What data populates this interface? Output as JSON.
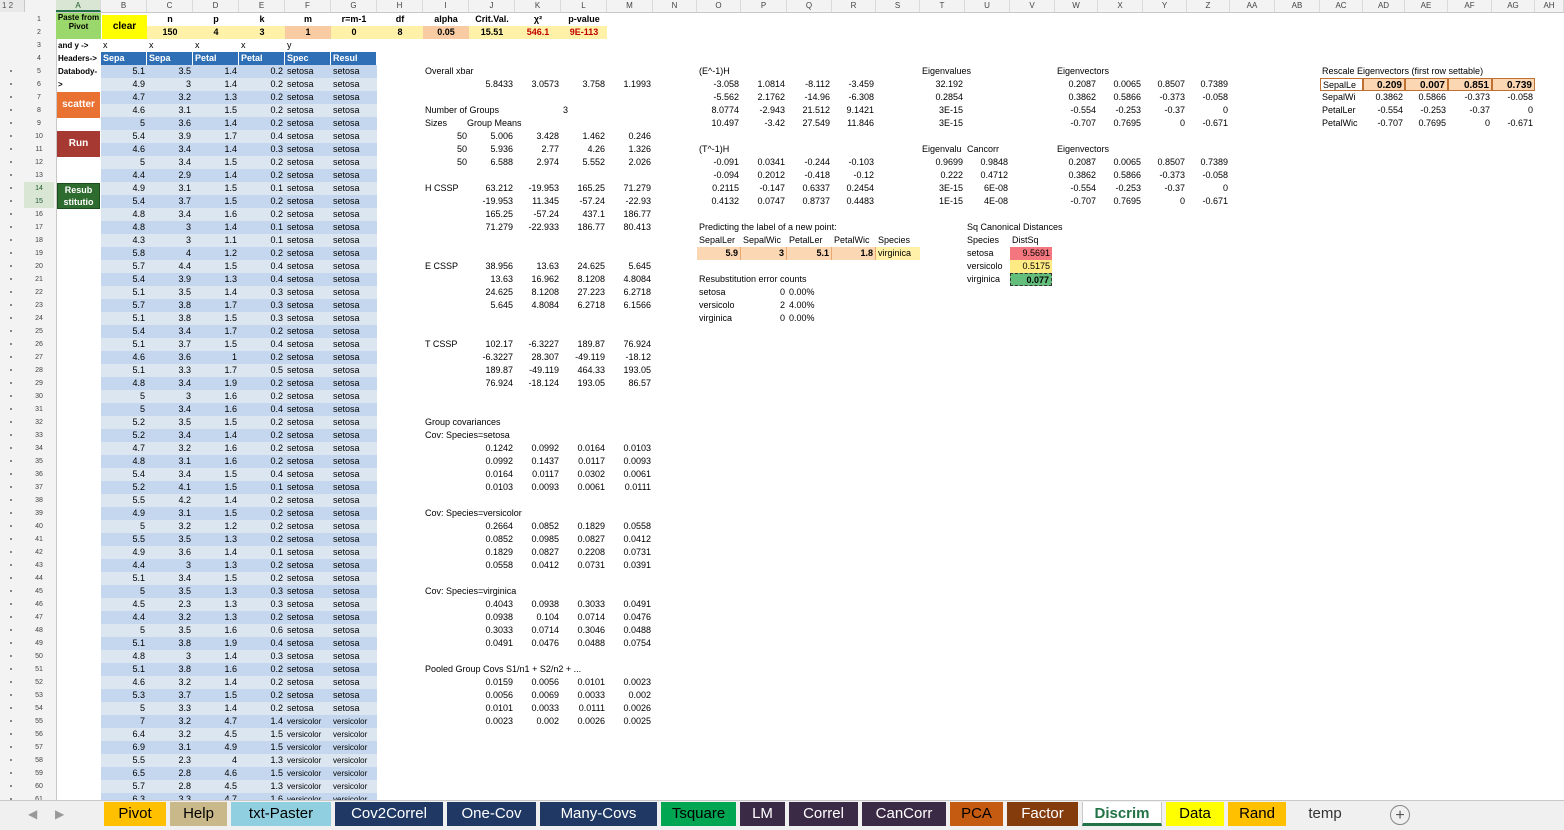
{
  "outline_levels": "1 2",
  "columns": [
    "A",
    "B",
    "C",
    "D",
    "E",
    "F",
    "G",
    "H",
    "I",
    "J",
    "K",
    "L",
    "M",
    "N",
    "O",
    "P",
    "Q",
    "R",
    "S",
    "T",
    "U",
    "V",
    "W",
    "X",
    "Y",
    "Z",
    "AA",
    "AB",
    "AC",
    "AD",
    "AE",
    "AF",
    "AG",
    "AH"
  ],
  "selected_column": "A",
  "row_numbers": [
    "1",
    "2",
    "3",
    "4",
    "5",
    "6",
    "7",
    "8",
    "9",
    "10",
    "11",
    "12",
    "13",
    "14",
    "15",
    "16",
    "17",
    "18",
    "19",
    "20",
    "21",
    "22",
    "23",
    "24",
    "25",
    "26",
    "27",
    "28",
    "29",
    "30",
    "31",
    "32",
    "33",
    "34",
    "35",
    "36",
    "37",
    "38",
    "39",
    "40",
    "41",
    "42",
    "43",
    "44",
    "45",
    "46",
    "47",
    "48",
    "49",
    "50",
    "51",
    "52",
    "53",
    "54",
    "55",
    "56",
    "57",
    "58",
    "59",
    "60",
    "61"
  ],
  "selected_rows": [
    "14",
    "15"
  ],
  "row_labels": {
    "r1": "Paste from Pivot",
    "r3": "and y ->",
    "r4": "Headers->",
    "r5": "Databody->"
  },
  "buttons": {
    "clear": "clear",
    "scatter": "scatter",
    "run": "Run",
    "resub": "Resub stitutio"
  },
  "params": {
    "headers": [
      "n",
      "p",
      "k",
      "m",
      "r=m-1",
      "df",
      "alpha",
      "Crit.Val.",
      "χ²",
      "p-value"
    ],
    "values": [
      "150",
      "4",
      "3",
      "1",
      "0",
      "8",
      "0.05",
      "15.51",
      "546.1",
      "9E-113"
    ]
  },
  "row3_marks": [
    "x",
    "x",
    "x",
    "x",
    "y"
  ],
  "table": {
    "headers": [
      "Sepa",
      "Sepa",
      "Petal",
      "Petal",
      "Spec",
      "Resul"
    ],
    "rows": [
      [
        "5.1",
        "3.5",
        "1.4",
        "0.2",
        "setosa",
        "setosa"
      ],
      [
        "4.9",
        "3",
        "1.4",
        "0.2",
        "setosa",
        "setosa"
      ],
      [
        "4.7",
        "3.2",
        "1.3",
        "0.2",
        "setosa",
        "setosa"
      ],
      [
        "4.6",
        "3.1",
        "1.5",
        "0.2",
        "setosa",
        "setosa"
      ],
      [
        "5",
        "3.6",
        "1.4",
        "0.2",
        "setosa",
        "setosa"
      ],
      [
        "5.4",
        "3.9",
        "1.7",
        "0.4",
        "setosa",
        "setosa"
      ],
      [
        "4.6",
        "3.4",
        "1.4",
        "0.3",
        "setosa",
        "setosa"
      ],
      [
        "5",
        "3.4",
        "1.5",
        "0.2",
        "setosa",
        "setosa"
      ],
      [
        "4.4",
        "2.9",
        "1.4",
        "0.2",
        "setosa",
        "setosa"
      ],
      [
        "4.9",
        "3.1",
        "1.5",
        "0.1",
        "setosa",
        "setosa"
      ],
      [
        "5.4",
        "3.7",
        "1.5",
        "0.2",
        "setosa",
        "setosa"
      ],
      [
        "4.8",
        "3.4",
        "1.6",
        "0.2",
        "setosa",
        "setosa"
      ],
      [
        "4.8",
        "3",
        "1.4",
        "0.1",
        "setosa",
        "setosa"
      ],
      [
        "4.3",
        "3",
        "1.1",
        "0.1",
        "setosa",
        "setosa"
      ],
      [
        "5.8",
        "4",
        "1.2",
        "0.2",
        "setosa",
        "setosa"
      ],
      [
        "5.7",
        "4.4",
        "1.5",
        "0.4",
        "setosa",
        "setosa"
      ],
      [
        "5.4",
        "3.9",
        "1.3",
        "0.4",
        "setosa",
        "setosa"
      ],
      [
        "5.1",
        "3.5",
        "1.4",
        "0.3",
        "setosa",
        "setosa"
      ],
      [
        "5.7",
        "3.8",
        "1.7",
        "0.3",
        "setosa",
        "setosa"
      ],
      [
        "5.1",
        "3.8",
        "1.5",
        "0.3",
        "setosa",
        "setosa"
      ],
      [
        "5.4",
        "3.4",
        "1.7",
        "0.2",
        "setosa",
        "setosa"
      ],
      [
        "5.1",
        "3.7",
        "1.5",
        "0.4",
        "setosa",
        "setosa"
      ],
      [
        "4.6",
        "3.6",
        "1",
        "0.2",
        "setosa",
        "setosa"
      ],
      [
        "5.1",
        "3.3",
        "1.7",
        "0.5",
        "setosa",
        "setosa"
      ],
      [
        "4.8",
        "3.4",
        "1.9",
        "0.2",
        "setosa",
        "setosa"
      ],
      [
        "5",
        "3",
        "1.6",
        "0.2",
        "setosa",
        "setosa"
      ],
      [
        "5",
        "3.4",
        "1.6",
        "0.4",
        "setosa",
        "setosa"
      ],
      [
        "5.2",
        "3.5",
        "1.5",
        "0.2",
        "setosa",
        "setosa"
      ],
      [
        "5.2",
        "3.4",
        "1.4",
        "0.2",
        "setosa",
        "setosa"
      ],
      [
        "4.7",
        "3.2",
        "1.6",
        "0.2",
        "setosa",
        "setosa"
      ],
      [
        "4.8",
        "3.1",
        "1.6",
        "0.2",
        "setosa",
        "setosa"
      ],
      [
        "5.4",
        "3.4",
        "1.5",
        "0.4",
        "setosa",
        "setosa"
      ],
      [
        "5.2",
        "4.1",
        "1.5",
        "0.1",
        "setosa",
        "setosa"
      ],
      [
        "5.5",
        "4.2",
        "1.4",
        "0.2",
        "setosa",
        "setosa"
      ],
      [
        "4.9",
        "3.1",
        "1.5",
        "0.2",
        "setosa",
        "setosa"
      ],
      [
        "5",
        "3.2",
        "1.2",
        "0.2",
        "setosa",
        "setosa"
      ],
      [
        "5.5",
        "3.5",
        "1.3",
        "0.2",
        "setosa",
        "setosa"
      ],
      [
        "4.9",
        "3.6",
        "1.4",
        "0.1",
        "setosa",
        "setosa"
      ],
      [
        "4.4",
        "3",
        "1.3",
        "0.2",
        "setosa",
        "setosa"
      ],
      [
        "5.1",
        "3.4",
        "1.5",
        "0.2",
        "setosa",
        "setosa"
      ],
      [
        "5",
        "3.5",
        "1.3",
        "0.3",
        "setosa",
        "setosa"
      ],
      [
        "4.5",
        "2.3",
        "1.3",
        "0.3",
        "setosa",
        "setosa"
      ],
      [
        "4.4",
        "3.2",
        "1.3",
        "0.2",
        "setosa",
        "setosa"
      ],
      [
        "5",
        "3.5",
        "1.6",
        "0.6",
        "setosa",
        "setosa"
      ],
      [
        "5.1",
        "3.8",
        "1.9",
        "0.4",
        "setosa",
        "setosa"
      ],
      [
        "4.8",
        "3",
        "1.4",
        "0.3",
        "setosa",
        "setosa"
      ],
      [
        "5.1",
        "3.8",
        "1.6",
        "0.2",
        "setosa",
        "setosa"
      ],
      [
        "4.6",
        "3.2",
        "1.4",
        "0.2",
        "setosa",
        "setosa"
      ],
      [
        "5.3",
        "3.7",
        "1.5",
        "0.2",
        "setosa",
        "setosa"
      ],
      [
        "5",
        "3.3",
        "1.4",
        "0.2",
        "setosa",
        "setosa"
      ],
      [
        "7",
        "3.2",
        "4.7",
        "1.4",
        "versicolor",
        "versicolor"
      ],
      [
        "6.4",
        "3.2",
        "4.5",
        "1.5",
        "versicolor",
        "versicolor"
      ],
      [
        "6.9",
        "3.1",
        "4.9",
        "1.5",
        "versicolor",
        "versicolor"
      ],
      [
        "5.5",
        "2.3",
        "4",
        "1.3",
        "versicolor",
        "versicolor"
      ],
      [
        "6.5",
        "2.8",
        "4.6",
        "1.5",
        "versicolor",
        "versicolor"
      ],
      [
        "5.7",
        "2.8",
        "4.5",
        "1.3",
        "versicolor",
        "versicolor"
      ],
      [
        "6.3",
        "3.3",
        "4.7",
        "1.6",
        "versicolor",
        "versicolor"
      ]
    ]
  },
  "block1": {
    "overall_xbar_label": "Overall xbar",
    "overall_xbar": [
      "5.8433",
      "3.0573",
      "3.758",
      "1.1993"
    ],
    "num_groups_label": "Number of Groups",
    "num_groups": "3",
    "sizes_label": "Sizes",
    "group_means_label": "Group Means",
    "group_rows": [
      [
        "50",
        "5.006",
        "3.428",
        "1.462",
        "0.246"
      ],
      [
        "50",
        "5.936",
        "2.77",
        "4.26",
        "1.326"
      ],
      [
        "50",
        "6.588",
        "2.974",
        "5.552",
        "2.026"
      ]
    ],
    "hcssp_label": "H CSSP",
    "hcssp": [
      [
        "63.212",
        "-19.953",
        "165.25",
        "71.279"
      ],
      [
        "-19.953",
        "11.345",
        "-57.24",
        "-22.93"
      ],
      [
        "165.25",
        "-57.24",
        "437.1",
        "186.77"
      ],
      [
        "71.279",
        "-22.933",
        "186.77",
        "80.413"
      ]
    ],
    "ecssp_label": "E CSSP",
    "ecssp": [
      [
        "38.956",
        "13.63",
        "24.625",
        "5.645"
      ],
      [
        "13.63",
        "16.962",
        "8.1208",
        "4.8084"
      ],
      [
        "24.625",
        "8.1208",
        "27.223",
        "6.2718"
      ],
      [
        "5.645",
        "4.8084",
        "6.2718",
        "6.1566"
      ]
    ],
    "tcssp_label": "T CSSP",
    "tcssp": [
      [
        "102.17",
        "-6.3227",
        "189.87",
        "76.924"
      ],
      [
        "-6.3227",
        "28.307",
        "-49.119",
        "-18.12"
      ],
      [
        "189.87",
        "-49.119",
        "464.33",
        "193.05"
      ],
      [
        "76.924",
        "-18.124",
        "193.05",
        "86.57"
      ]
    ],
    "group_cov_label": "Group covariances",
    "cov_setosa_label": "Cov: Species=setosa",
    "cov_setosa": [
      [
        "0.1242",
        "0.0992",
        "0.0164",
        "0.0103"
      ],
      [
        "0.0992",
        "0.1437",
        "0.0117",
        "0.0093"
      ],
      [
        "0.0164",
        "0.0117",
        "0.0302",
        "0.0061"
      ],
      [
        "0.0103",
        "0.0093",
        "0.0061",
        "0.0111"
      ]
    ],
    "cov_versicolor_label": "Cov: Species=versicolor",
    "cov_versicolor": [
      [
        "0.2664",
        "0.0852",
        "0.1829",
        "0.0558"
      ],
      [
        "0.0852",
        "0.0985",
        "0.0827",
        "0.0412"
      ],
      [
        "0.1829",
        "0.0827",
        "0.2208",
        "0.0731"
      ],
      [
        "0.0558",
        "0.0412",
        "0.0731",
        "0.0391"
      ]
    ],
    "cov_virginica_label": "Cov: Species=virginica",
    "cov_virginica": [
      [
        "0.4043",
        "0.0938",
        "0.3033",
        "0.0491"
      ],
      [
        "0.0938",
        "0.104",
        "0.0714",
        "0.0476"
      ],
      [
        "0.3033",
        "0.0714",
        "0.3046",
        "0.0488"
      ],
      [
        "0.0491",
        "0.0476",
        "0.0488",
        "0.0754"
      ]
    ],
    "pooled_label": "Pooled Group Covs S1/n1 + S2/n2 + ...",
    "pooled": [
      [
        "0.0159",
        "0.0056",
        "0.0101",
        "0.0023"
      ],
      [
        "0.0056",
        "0.0069",
        "0.0033",
        "0.002"
      ],
      [
        "0.0101",
        "0.0033",
        "0.0111",
        "0.0026"
      ],
      [
        "0.0023",
        "0.002",
        "0.0026",
        "0.0025"
      ]
    ]
  },
  "block2": {
    "einvh_label": "(E^-1)H",
    "einvh": [
      [
        "-3.058",
        "1.0814",
        "-8.112",
        "-3.459"
      ],
      [
        "-5.562",
        "2.1762",
        "-14.96",
        "-6.308"
      ],
      [
        "8.0774",
        "-2.943",
        "21.512",
        "9.1421"
      ],
      [
        "10.497",
        "-3.42",
        "27.549",
        "11.846"
      ]
    ],
    "tinvh_label": "(T^-1)H",
    "tinvh": [
      [
        "-0.091",
        "0.0341",
        "-0.244",
        "-0.103"
      ],
      [
        "-0.094",
        "0.2012",
        "-0.418",
        "-0.12"
      ],
      [
        "0.2115",
        "-0.147",
        "0.6337",
        "0.2454"
      ],
      [
        "0.4132",
        "0.0747",
        "0.8737",
        "0.4483"
      ]
    ],
    "predict_label": "Predicting the label of a new point:",
    "predict_headers": [
      "SepalLer",
      "SepalWic",
      "PetalLer",
      "PetalWic",
      "Species"
    ],
    "predict_values": [
      "5.9",
      "3",
      "5.1",
      "1.8"
    ],
    "predict_species": "virginica",
    "resub_label": "Resubstitution error counts",
    "resub_rows": [
      [
        "setosa",
        "0",
        "0.00%"
      ],
      [
        "versicolo",
        "2",
        "4.00%"
      ],
      [
        "virginica",
        "0",
        "0.00%"
      ]
    ]
  },
  "block3": {
    "eigenvalues_label": "Eigenvalues",
    "eigenvalues": [
      "32.192",
      "0.2854",
      "3E-15",
      "3E-15"
    ],
    "eigenvectors_label": "Eigenvectors",
    "eigenvectors": [
      [
        "0.2087",
        "0.0065",
        "0.8507",
        "0.7389"
      ],
      [
        "0.3862",
        "0.5866",
        "-0.373",
        "-0.058"
      ],
      [
        "-0.554",
        "-0.253",
        "-0.37",
        "0"
      ],
      [
        "-0.707",
        "0.7695",
        "0",
        "-0.671"
      ]
    ],
    "eigenval2_label": "Eigenvalu",
    "cancorr_label": "Cancorr",
    "eig2_rows": [
      [
        "0.9699",
        "0.9848"
      ],
      [
        "0.222",
        "0.4712"
      ],
      [
        "3E-15",
        "6E-08"
      ],
      [
        "1E-15",
        "4E-08"
      ]
    ],
    "eigenvectors2_label": "Eigenvectors",
    "eigenvectors2": [
      [
        "0.2087",
        "0.0065",
        "0.8507",
        "0.7389"
      ],
      [
        "0.3862",
        "0.5866",
        "-0.373",
        "-0.058"
      ],
      [
        "-0.554",
        "-0.253",
        "-0.37",
        "0"
      ],
      [
        "-0.707",
        "0.7695",
        "0",
        "-0.671"
      ]
    ],
    "sqcan_label": "Sq Canonical Distances",
    "sqcan_headers": [
      "Species",
      "DistSq"
    ],
    "sqcan_rows": [
      [
        "setosa",
        "9.5691"
      ],
      [
        "versicolo",
        "0.5175"
      ],
      [
        "virginica",
        "0.077"
      ]
    ]
  },
  "block4": {
    "rescale_label": "Rescale Eigenvectors (first row settable)",
    "rows": [
      [
        "SepalLe",
        "0.209",
        "0.007",
        "0.851",
        "0.739"
      ],
      [
        "SepalWi",
        "0.3862",
        "0.5866",
        "-0.373",
        "-0.058"
      ],
      [
        "PetalLer",
        "-0.554",
        "-0.253",
        "-0.37",
        "0"
      ],
      [
        "PetalWic",
        "-0.707",
        "0.7695",
        "0",
        "-0.671"
      ]
    ]
  },
  "tabs": [
    {
      "label": "Pivot",
      "bg": "#ffc000",
      "fg": "#000000"
    },
    {
      "label": "Help",
      "bg": "#c9b98a",
      "fg": "#000000"
    },
    {
      "label": "txt-Paster",
      "bg": "#8fcfe0",
      "fg": "#000000"
    },
    {
      "label": "Cov2Correl",
      "bg": "#1f3864",
      "fg": "#ffffff"
    },
    {
      "label": "One-Cov",
      "bg": "#1f3864",
      "fg": "#ffffff"
    },
    {
      "label": "Many-Covs",
      "bg": "#1f3864",
      "fg": "#ffffff"
    },
    {
      "label": "Tsquare",
      "bg": "#00a651",
      "fg": "#000000"
    },
    {
      "label": "LM",
      "bg": "#3b2a45",
      "fg": "#ffffff"
    },
    {
      "label": "Correl",
      "bg": "#3b2a45",
      "fg": "#ffffff"
    },
    {
      "label": "CanCorr",
      "bg": "#3b2a45",
      "fg": "#ffffff"
    },
    {
      "label": "PCA",
      "bg": "#c55a11",
      "fg": "#000000"
    },
    {
      "label": "Factor",
      "bg": "#843c0c",
      "fg": "#ffffff"
    },
    {
      "label": "Discrim",
      "bg": "#ffffff",
      "fg": "#217346"
    },
    {
      "label": "Data",
      "bg": "#ffff00",
      "fg": "#000000"
    },
    {
      "label": "Rand",
      "bg": "#ffc000",
      "fg": "#000000"
    },
    {
      "label": "temp",
      "bg": "#f0f0f0",
      "fg": "#333333"
    }
  ],
  "active_tab": "Discrim",
  "add_sheet_glyph": "+",
  "nav_left_glyph": "◀",
  "nav_right_glyph": "▶"
}
